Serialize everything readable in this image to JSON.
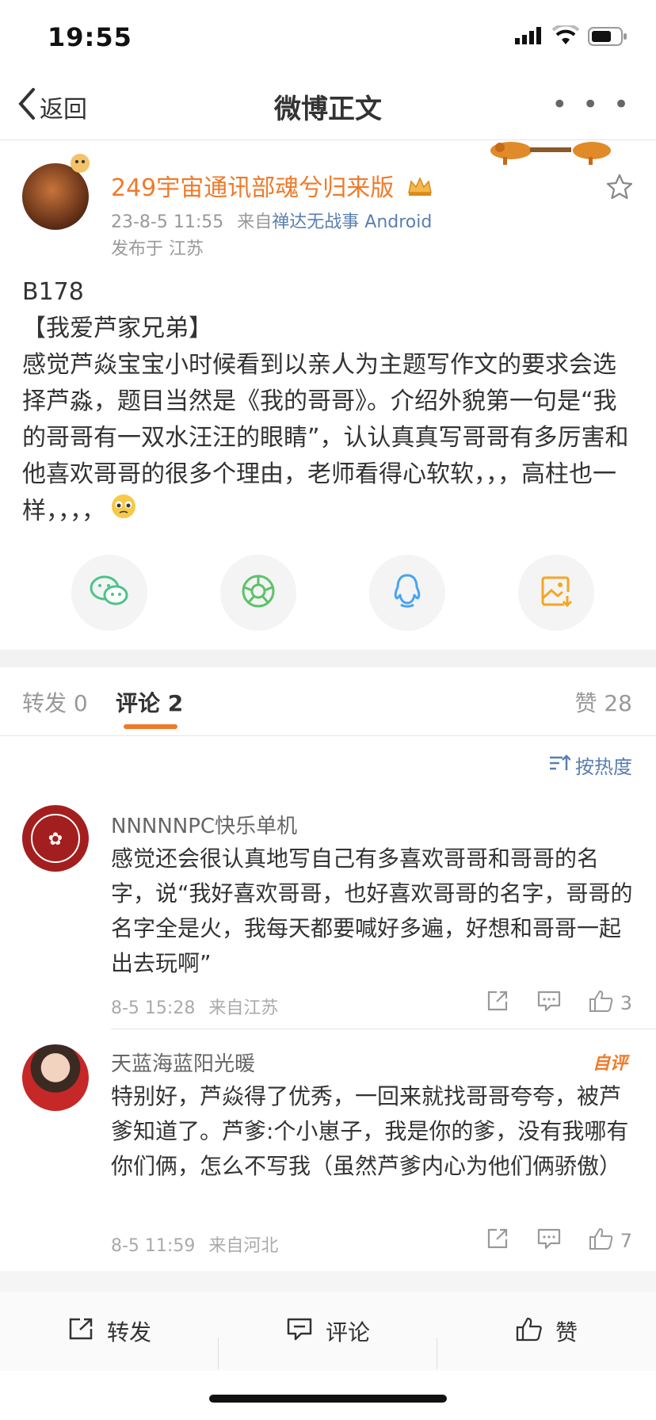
{
  "status_bar": {
    "time": "19:55"
  },
  "nav": {
    "back_label": "返回",
    "title": "微博正文",
    "more_label": "• • •"
  },
  "post": {
    "username": "249宇宙通讯部魂兮归来版",
    "date": "23-8-5 11:55",
    "from_prefix": "来自",
    "source": "禅达无战事 Android",
    "location": "发布于 江苏",
    "content": "B178\n【我爱芦家兄弟】\n感觉芦焱宝宝小时候看到以亲人为主题写作文的要求会选择芦淼，题目当然是《我的哥哥》。介绍外貌第一句是“我的哥哥有一双水汪汪的眼睛”，认认真真写哥哥有多厉害和他喜欢哥哥的很多个理由，老师看得心软软，，，高柱也一样，，，，"
  },
  "share_icons": [
    "wechat-icon",
    "moments-icon",
    "qq-icon",
    "save-image-icon"
  ],
  "tabs": {
    "repost": "转发 0",
    "comment": "评论 2",
    "like": "赞 28"
  },
  "sort_label": "按热度",
  "comments": [
    {
      "name": "NNNNNPC快乐单机",
      "text": "感觉还会很认真地写自己有多喜欢哥哥和哥哥的名字，说“我好喜欢哥哥，也好喜欢哥哥的名字，哥哥的名字全是火，我每天都要喊好多遍，好想和哥哥一起出去玩啊”",
      "time": "8-5 15:28",
      "from": "来自江苏",
      "likes": "3"
    },
    {
      "name": "天蓝海蓝阳光暖",
      "tag": "自评",
      "text": "特别好，芦焱得了优秀，一回来就找哥哥夸夸，被芦爹知道了。芦爹:个小崽子，我是你的爹，没有我哪有你们俩，怎么不写我（虽然芦爹内心为他们俩骄傲）",
      "time": "8-5 11:59",
      "from": "来自河北",
      "likes": "7"
    }
  ],
  "toolbar": {
    "repost": "转发",
    "comment": "评论",
    "like": "赞"
  },
  "colors": {
    "accent": "#f07a2a",
    "link": "#5a7fb0",
    "muted": "#999999"
  }
}
